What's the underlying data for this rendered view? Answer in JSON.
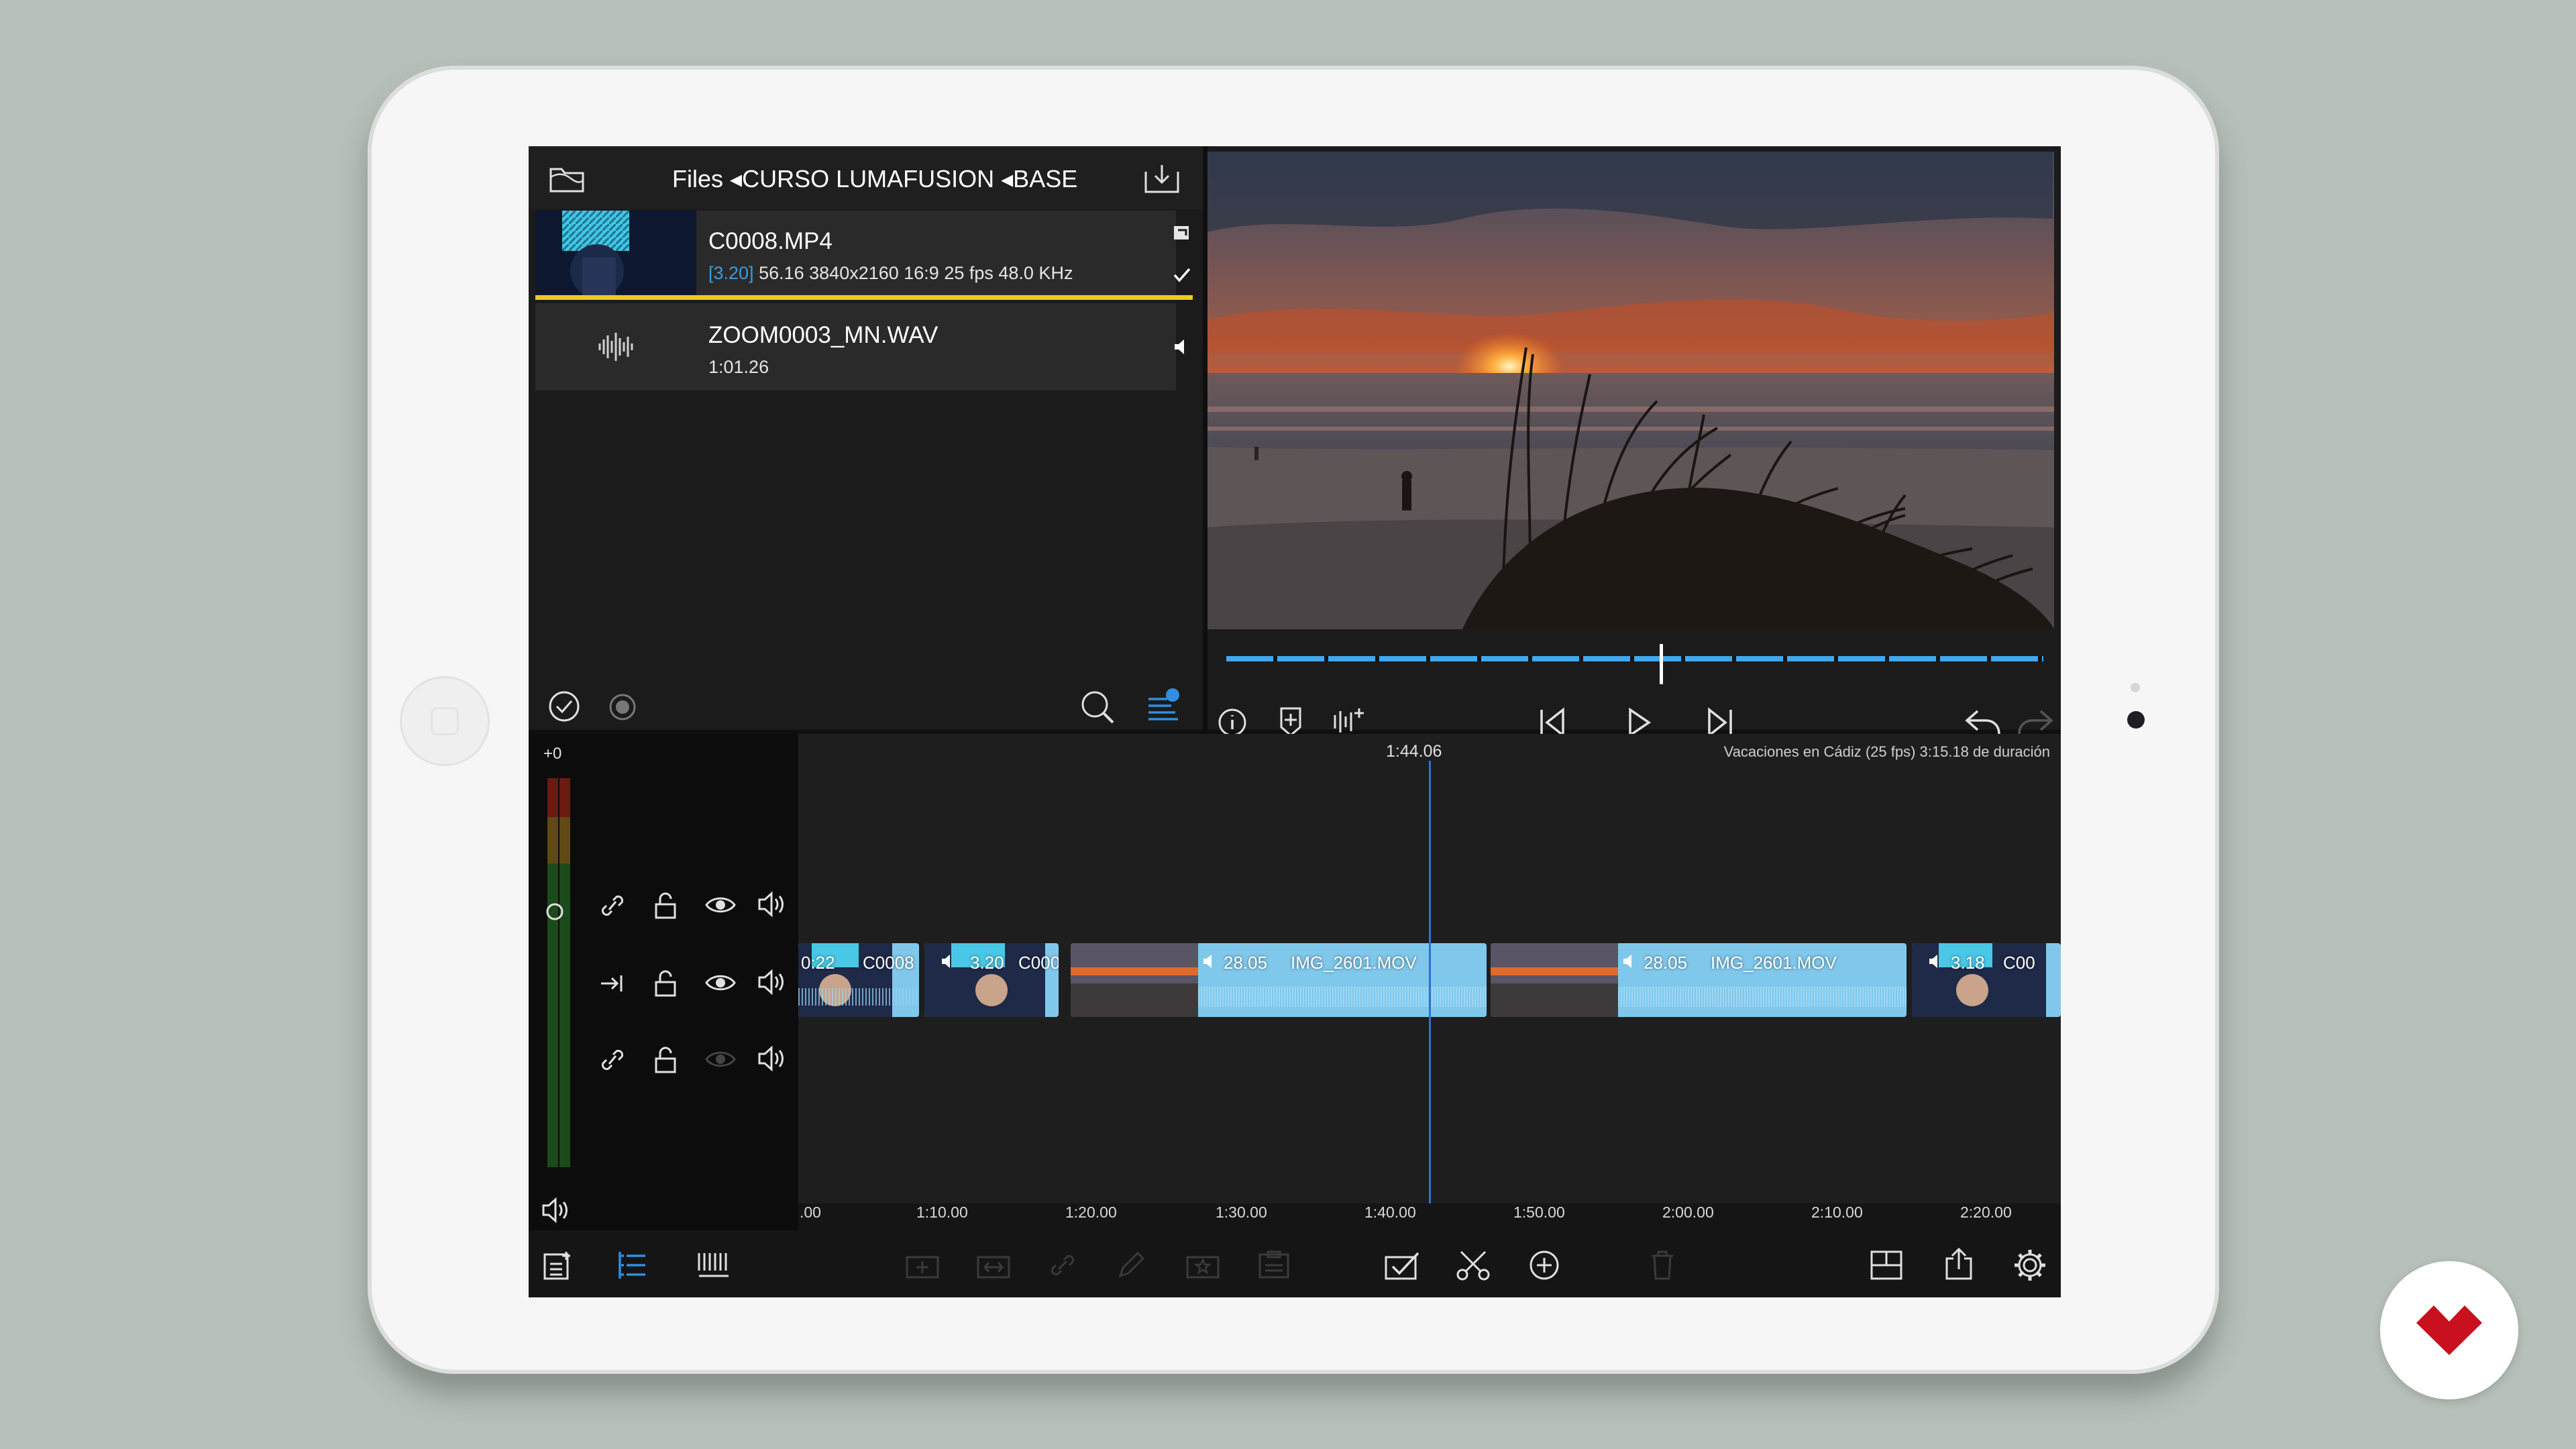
{
  "library": {
    "breadcrumb": "Files ◂CURSO LUMAFUSION ◂BASE",
    "clips": [
      {
        "name": "C0008.MP4",
        "meta_tag": "[3.20]",
        "meta": "56.16  3840x2160  16:9  25 fps  48.0 KHz",
        "selected": true
      },
      {
        "name": "ZOOM0003_MN.WAV",
        "meta": "1:01.26",
        "selected": false
      }
    ]
  },
  "preview": {
    "scrub_position": 0.53
  },
  "timeline": {
    "playhead_time": "1:44.06",
    "project_info": "Vacaciones en Cádiz  (25 fps) 3:15.18 de duración",
    "meter_label": "+0",
    "clips": [
      {
        "time": "0:22",
        "name": "C0008"
      },
      {
        "time": "3.20",
        "name": "C000"
      },
      {
        "time": "28.05",
        "name": "IMG_2601.MOV"
      },
      {
        "time": "28.05",
        "name": "IMG_2601.MOV"
      },
      {
        "time": "3.18",
        "name": "C00"
      }
    ],
    "ruler": [
      ".00",
      "1:10.00",
      "1:20.00",
      "1:30.00",
      "1:40.00",
      "1:50.00",
      "2:00.00",
      "2:10.00",
      "2:20.00"
    ]
  },
  "colors": {
    "accent_blue": "#2f8fe0",
    "clip_blue": "#7fc8ec",
    "selection_yellow": "#f2c81a",
    "badge_red": "#c8101e"
  }
}
